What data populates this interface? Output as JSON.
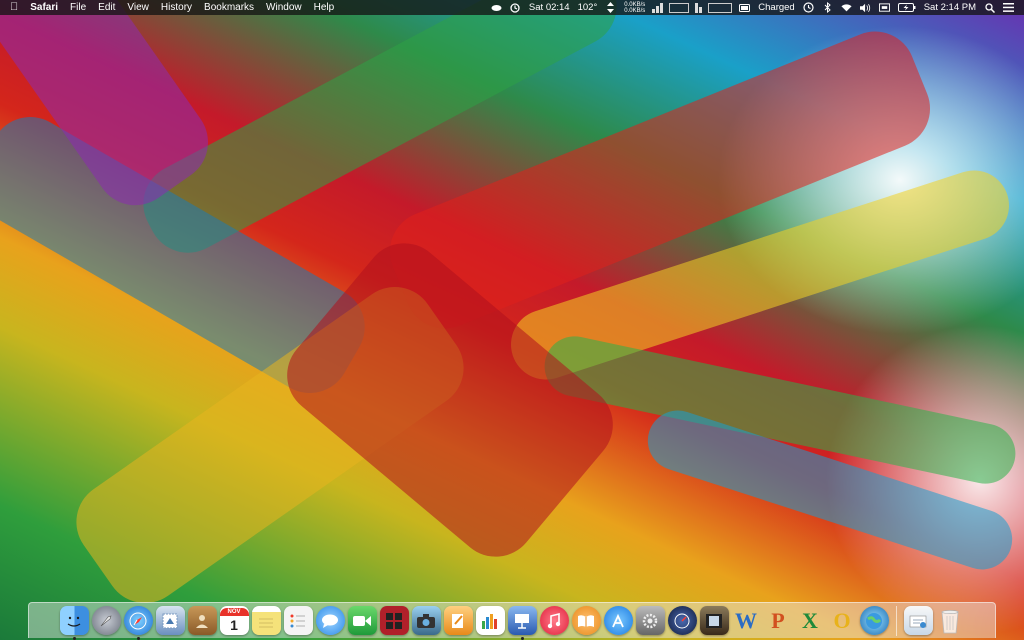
{
  "menubar": {
    "apple": "",
    "app_name": "Safari",
    "menus": [
      "File",
      "Edit",
      "View",
      "History",
      "Bookmarks",
      "Window",
      "Help"
    ],
    "status": {
      "clock_small": "Sat 02:14",
      "temperature": "102°",
      "net_up": "0.0KB/s",
      "net_down": "0.0KB/s",
      "battery_text": "Charged",
      "datetime": "Sat 2:14 PM"
    }
  },
  "dock": {
    "calendar_month": "NOV",
    "calendar_day": "1",
    "items": [
      {
        "name": "finder",
        "color": "#3d8fe0"
      },
      {
        "name": "launchpad",
        "color": "#8a8f99"
      },
      {
        "name": "safari",
        "color": "#1e7fe0"
      },
      {
        "name": "mail",
        "color": "#6a8fbf"
      },
      {
        "name": "contacts",
        "color": "#a8763c"
      },
      {
        "name": "calendar",
        "color": "#ffffff"
      },
      {
        "name": "notes",
        "color": "#f5e27a"
      },
      {
        "name": "reminders",
        "color": "#f0f0f0"
      },
      {
        "name": "messages",
        "color": "#4aa3ff"
      },
      {
        "name": "facetime",
        "color": "#2fb34a"
      },
      {
        "name": "photo-booth",
        "color": "#c0292c"
      },
      {
        "name": "iphoto",
        "color": "#5b8fb0"
      },
      {
        "name": "pages",
        "color": "#f0a53a"
      },
      {
        "name": "numbers",
        "color": "#ffffff"
      },
      {
        "name": "keynote",
        "color": "#2a6fcc"
      },
      {
        "name": "itunes",
        "color": "#f03b58"
      },
      {
        "name": "ibooks",
        "color": "#f29a26"
      },
      {
        "name": "app-store",
        "color": "#2a8fea"
      },
      {
        "name": "system-preferences",
        "color": "#8a8a8a"
      },
      {
        "name": "dashboard",
        "color": "#2a3a6a"
      },
      {
        "name": "imovie",
        "color": "#6a5a3a"
      },
      {
        "name": "word",
        "color": "#2b6cc4"
      },
      {
        "name": "powerpoint",
        "color": "#d2501f"
      },
      {
        "name": "excel",
        "color": "#1f8a3a"
      },
      {
        "name": "outlook",
        "color": "#e8b21a"
      },
      {
        "name": "network-globe",
        "color": "#3a8ad0"
      }
    ],
    "letters": {
      "word": "W",
      "powerpoint": "P",
      "excel": "X",
      "outlook": "O"
    }
  }
}
